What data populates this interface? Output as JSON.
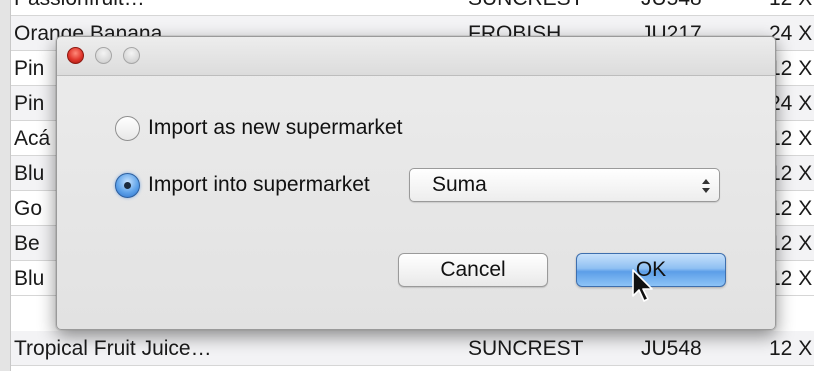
{
  "background_table": {
    "rows": [
      {
        "name": "Passionfruit…",
        "brand": "SUNCREST",
        "code": "JU548",
        "qty": "12 X"
      },
      {
        "name": "Orange Banana",
        "brand": "FROBISH",
        "code": "JU217",
        "qty": "24 X"
      },
      {
        "name": "Pin",
        "brand": "",
        "code": "",
        "qty": "12 X"
      },
      {
        "name": "Pin",
        "brand": "",
        "code": "",
        "qty": "24 X"
      },
      {
        "name": "Acá",
        "brand": "",
        "code": "",
        "qty": "12 X"
      },
      {
        "name": "Blu",
        "brand": "",
        "code": "",
        "qty": "12 X"
      },
      {
        "name": "Go",
        "brand": "",
        "code": "",
        "qty": "12 X"
      },
      {
        "name": "Be",
        "brand": "",
        "code": "",
        "qty": "12 X"
      },
      {
        "name": "Blu",
        "brand": "",
        "code": "",
        "qty": "12 X"
      },
      {
        "name": "Tropical Fruit Juice…",
        "brand": "SUNCREST",
        "code": "JU548",
        "qty": "12 X"
      }
    ]
  },
  "dialog": {
    "option_new_label": "Import as new supermarket",
    "option_into_label": "Import into supermarket",
    "selected_option": "into",
    "supermarket_value": "Suma",
    "cancel_label": "Cancel",
    "ok_label": "OK"
  },
  "colors": {
    "close_button": "#e0362c",
    "default_button": "#5c9ee8",
    "dialog_bg": "#e6e6e6"
  }
}
